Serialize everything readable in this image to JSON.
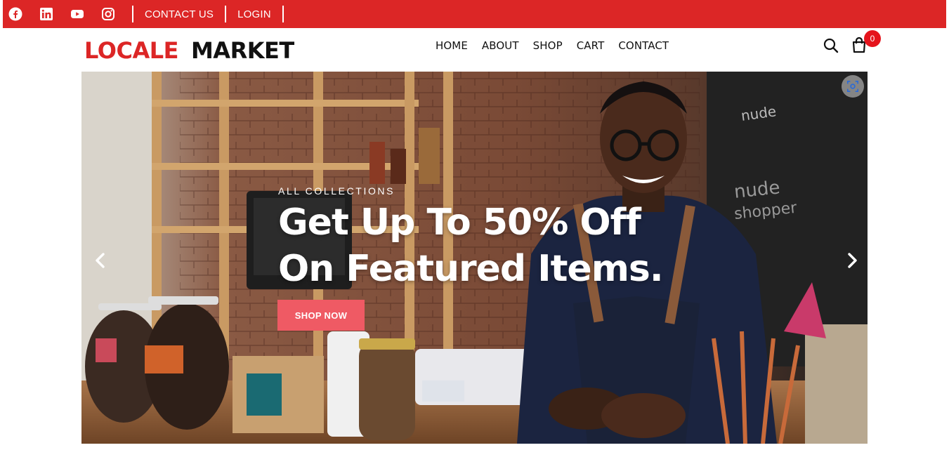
{
  "topbar": {
    "social_icons": [
      "facebook-icon",
      "linkedin-icon",
      "youtube-icon",
      "instagram-icon"
    ],
    "links": {
      "contact": "CONTACT US",
      "login": "LOGIN"
    },
    "bg_color": "#dc2626"
  },
  "header": {
    "logo_part1": "LOCALE",
    "logo_part2": "MARKET",
    "nav": {
      "home": "HOME",
      "about": "ABOUT",
      "shop": "SHOP",
      "cart": "CART",
      "contact": "CONTACT"
    },
    "cart_count": "0",
    "icons": [
      "search-icon",
      "shopping-bag-icon"
    ]
  },
  "hero": {
    "eyebrow": "ALL COLLECTIONS",
    "headline_line1": "Get Up To 50% Off",
    "headline_line2": "On Featured Items.",
    "cta": "SHOP NOW",
    "cta_color": "#ef5a64",
    "icons": [
      "chevron-left-icon",
      "chevron-right-icon",
      "visual-search-icon"
    ]
  }
}
